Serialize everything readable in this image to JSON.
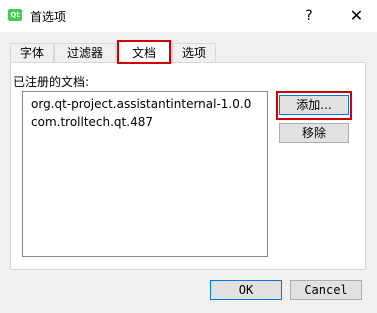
{
  "window": {
    "title": "首选项",
    "app_icon_text": "Qt",
    "help_label": "?",
    "close_label": "✕"
  },
  "tabs": [
    {
      "label": "字体",
      "selected": false
    },
    {
      "label": "过滤器",
      "selected": false
    },
    {
      "label": "文档",
      "selected": true
    },
    {
      "label": "选项",
      "selected": false
    }
  ],
  "documents": {
    "label": "已注册的文档:",
    "items": [
      "org.qt-project.assistantinternal-1.0.0",
      "com.trolltech.qt.487"
    ],
    "add_label": "添加...",
    "remove_label": "移除"
  },
  "footer": {
    "ok_label": "OK",
    "cancel_label": "Cancel"
  },
  "colors": {
    "highlight": "#d00000",
    "focus": "#0078d7",
    "qt_green": "#41cd52"
  }
}
